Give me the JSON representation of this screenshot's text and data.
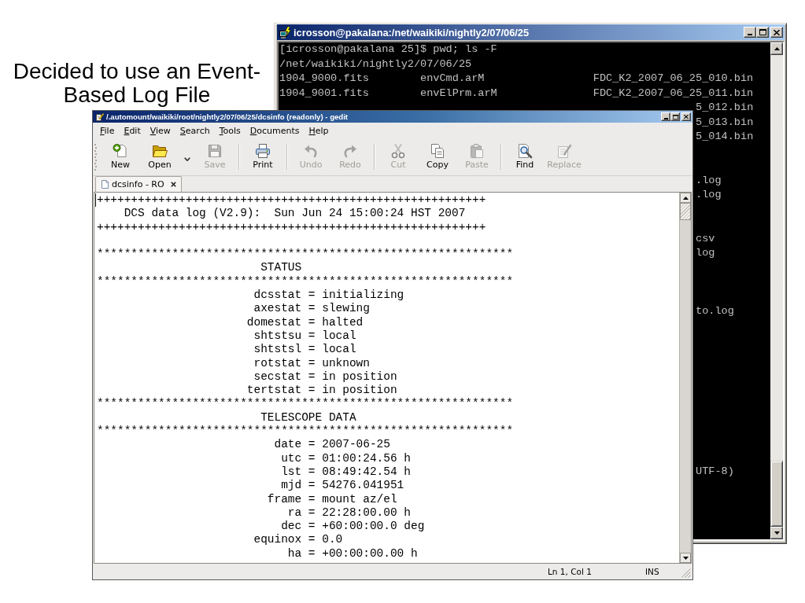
{
  "caption": "Decided to use an Event-Based Log File",
  "terminal": {
    "title": "icrosson@pakalana:/net/waikiki/nightly2/07/06/25",
    "lines": [
      {
        "kind": "text",
        "text": "[icrosson@pakalana 25]$ pwd; ls -F"
      },
      {
        "kind": "text",
        "text": "/net/waikiki/nightly2/07/06/25"
      },
      {
        "kind": "columns",
        "cells": [
          "1904_9000.fits",
          "envCmd.arM",
          "FDC_K2_2007_06_25_010.bin"
        ]
      },
      {
        "kind": "columns",
        "cells": [
          "1904_9001.fits",
          "envElPrm.arM",
          "FDC_K2_2007_06_25_011.bin"
        ]
      },
      {
        "kind": "tail",
        "text": "5_012.bin"
      },
      {
        "kind": "tail",
        "text": "5_013.bin"
      },
      {
        "kind": "tail",
        "text": "5_014.bin"
      },
      {
        "kind": "blank"
      },
      {
        "kind": "blank"
      },
      {
        "kind": "tail",
        "text": ".log"
      },
      {
        "kind": "tail",
        "text": ".log"
      },
      {
        "kind": "blank"
      },
      {
        "kind": "blank"
      },
      {
        "kind": "tail",
        "text": "csv"
      },
      {
        "kind": "tail",
        "text": "log"
      },
      {
        "kind": "blank"
      },
      {
        "kind": "blank"
      },
      {
        "kind": "blank"
      },
      {
        "kind": "tail",
        "text": "to.log"
      },
      {
        "kind": "blank"
      },
      {
        "kind": "blank"
      },
      {
        "kind": "blank"
      },
      {
        "kind": "blank"
      },
      {
        "kind": "blank"
      },
      {
        "kind": "blank"
      },
      {
        "kind": "blank"
      },
      {
        "kind": "blank"
      },
      {
        "kind": "blank"
      },
      {
        "kind": "blank"
      },
      {
        "kind": "tail",
        "text": "UTF-8)"
      }
    ]
  },
  "editor": {
    "title": "/.automount/waikiki/root/nightly2/07/06/25/dcsinfo (readonly) - gedit",
    "menu": [
      "File",
      "Edit",
      "View",
      "Search",
      "Tools",
      "Documents",
      "Help"
    ],
    "toolbar": [
      {
        "kind": "button",
        "label": "New",
        "disabled": false
      },
      {
        "kind": "button",
        "label": "Open",
        "disabled": false
      },
      {
        "kind": "dropdown"
      },
      {
        "kind": "button",
        "label": "Save",
        "disabled": true
      },
      {
        "kind": "separator"
      },
      {
        "kind": "button",
        "label": "Print",
        "disabled": false
      },
      {
        "kind": "separator"
      },
      {
        "kind": "button",
        "label": "Undo",
        "disabled": true
      },
      {
        "kind": "button",
        "label": "Redo",
        "disabled": true
      },
      {
        "kind": "separator"
      },
      {
        "kind": "button",
        "label": "Cut",
        "disabled": true
      },
      {
        "kind": "button",
        "label": "Copy",
        "disabled": false
      },
      {
        "kind": "button",
        "label": "Paste",
        "disabled": true
      },
      {
        "kind": "separator"
      },
      {
        "kind": "button",
        "label": "Find",
        "disabled": false
      },
      {
        "kind": "button",
        "label": "Replace",
        "disabled": true
      }
    ],
    "tabs": [
      {
        "label": "dcsinfo - RO",
        "selected": true
      }
    ],
    "lines": [
      {
        "kind": "rule",
        "text": "+++++++++++++++++++++++++++++++++++++++++++++++++++++++++"
      },
      {
        "kind": "banner",
        "text": "DCS data log (V2.9):  Sun Jun 24 15:00:24 HST 2007"
      },
      {
        "kind": "rule",
        "text": "+++++++++++++++++++++++++++++++++++++++++++++++++++++++++"
      },
      {
        "kind": "blank"
      },
      {
        "kind": "rule",
        "text": "*************************************************************"
      },
      {
        "kind": "heading",
        "text": "STATUS"
      },
      {
        "kind": "rule",
        "text": "*************************************************************"
      },
      {
        "kind": "field",
        "text": "dcsstat = initializing"
      },
      {
        "kind": "field",
        "text": "axestat = slewing"
      },
      {
        "kind": "field",
        "text": "domestat = halted"
      },
      {
        "kind": "field",
        "text": "shtstsu = local"
      },
      {
        "kind": "field",
        "text": "shtstsl = local"
      },
      {
        "kind": "field",
        "text": "rotstat = unknown"
      },
      {
        "kind": "field",
        "text": "secstat = in position"
      },
      {
        "kind": "field",
        "text": "tertstat = in position"
      },
      {
        "kind": "rule",
        "text": "*************************************************************"
      },
      {
        "kind": "heading",
        "text": "TELESCOPE DATA"
      },
      {
        "kind": "rule",
        "text": "*************************************************************"
      },
      {
        "kind": "field",
        "text": "date = 2007-06-25"
      },
      {
        "kind": "field",
        "text": "utc = 01:00:24.56 h"
      },
      {
        "kind": "field",
        "text": "lst = 08:49:42.54 h"
      },
      {
        "kind": "field",
        "text": "mjd = 54276.041951"
      },
      {
        "kind": "field",
        "text": "frame = mount az/el"
      },
      {
        "kind": "field",
        "text": "ra = 22:28:00.00 h"
      },
      {
        "kind": "field",
        "text": "dec = +60:00:00.0 deg"
      },
      {
        "kind": "field",
        "text": "equinox = 0.0"
      },
      {
        "kind": "field",
        "text": "ha = +00:00:00.00 h"
      }
    ],
    "status_bar": {
      "position": "Ln 1, Col 1",
      "mode": "INS"
    }
  }
}
